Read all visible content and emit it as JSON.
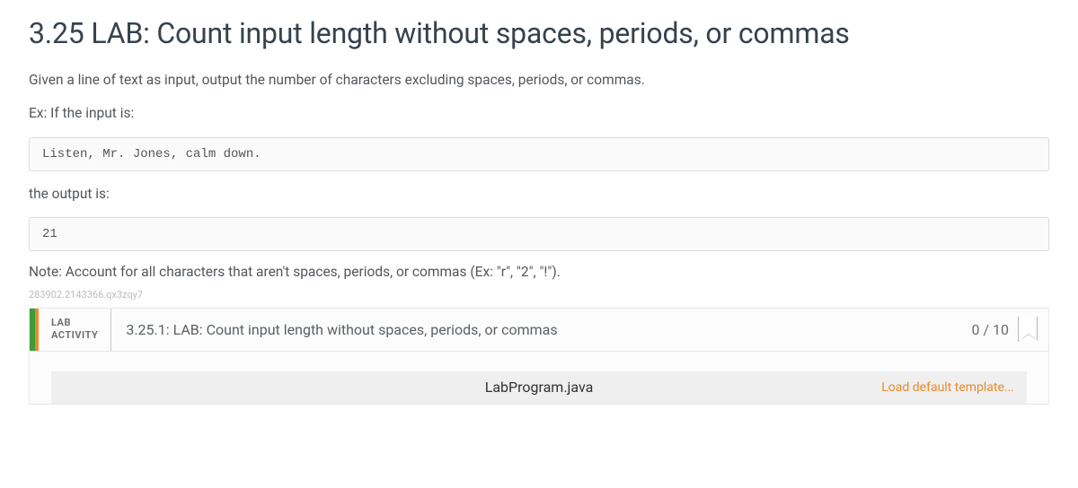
{
  "title": "3.25 LAB: Count input length without spaces, periods, or commas",
  "description": "Given a line of text as input, output the number of characters excluding spaces, periods, or commas.",
  "example_intro": "Ex: If the input is:",
  "example_input": "Listen, Mr. Jones, calm down.",
  "output_intro": "the output is:",
  "example_output": "21",
  "note": "Note: Account for all characters that aren't spaces, periods, or commas (Ex: \"r\", \"2\", \"!\").",
  "ref_id": "283902.2143366.qx3zqy7",
  "activity": {
    "badge_line1": "LAB",
    "badge_line2": "ACTIVITY",
    "title": "3.25.1: LAB: Count input length without spaces, periods, or commas",
    "score": "0 / 10",
    "filename": "LabProgram.java",
    "load_link": "Load default template..."
  }
}
